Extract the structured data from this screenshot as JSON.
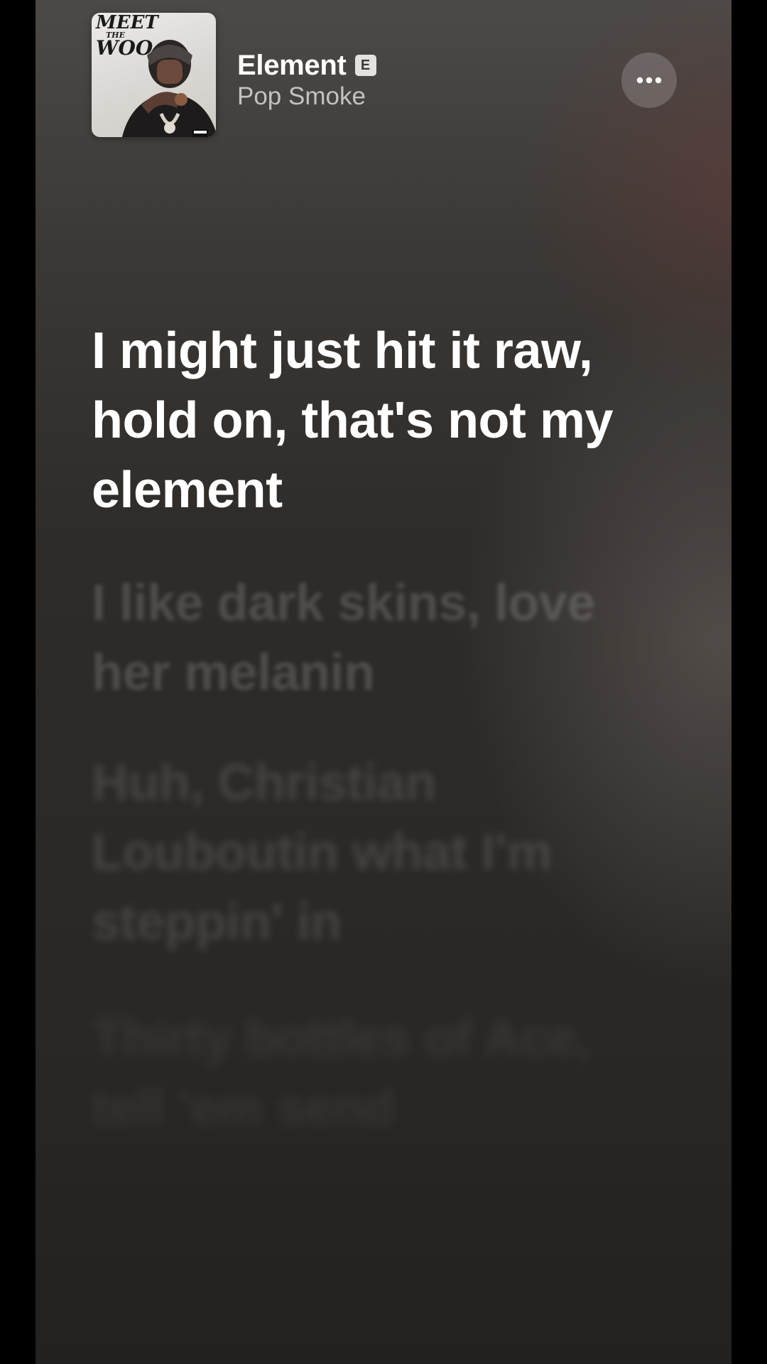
{
  "now_playing": {
    "album_art": {
      "title_line1": "MEET",
      "title_line2": "THE",
      "title_line3": "WOO",
      "advisory": "PARENTAL ADVISORY"
    },
    "track_title": "Element",
    "explicit_badge": "E",
    "artist": "Pop Smoke",
    "more_icon": "ellipsis-icon"
  },
  "lyrics": {
    "active": "I might just hit it raw, hold on, that's not my element",
    "next": [
      "I like dark skins, love her melanin",
      "Huh, Christian Louboutin what I'm steppin' in",
      "Thirty bottles of Ace, tell 'em send"
    ]
  },
  "colors": {
    "background_top": "#4c4947",
    "background_bottom": "#232120",
    "active_lyric": "#ffffff",
    "artist_text": "rgba(255,255,255,0.68)"
  }
}
